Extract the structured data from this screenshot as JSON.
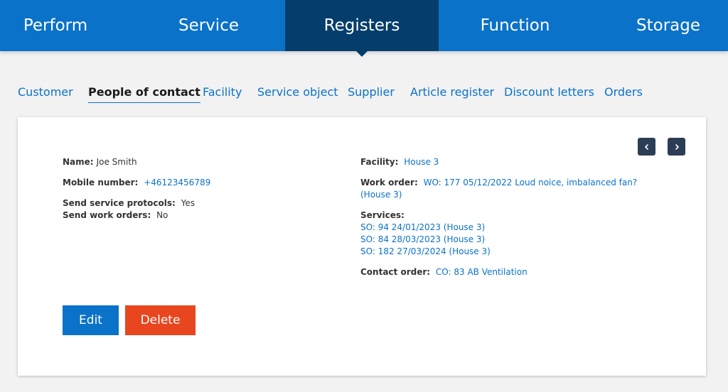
{
  "topnav": {
    "tabs": [
      {
        "label": "Perform"
      },
      {
        "label": "Service"
      },
      {
        "label": "Registers"
      },
      {
        "label": "Function"
      },
      {
        "label": "Storage"
      }
    ]
  },
  "subnav": {
    "tabs": [
      {
        "label": "Customer"
      },
      {
        "label": "People of contact"
      },
      {
        "label": "Facility"
      },
      {
        "label": "Service object"
      },
      {
        "label": "Supplier"
      },
      {
        "label": "Article register"
      },
      {
        "label": "Discount letters"
      },
      {
        "label": "Orders"
      }
    ]
  },
  "contact": {
    "name_label": "Name:",
    "name": "Joe Smith",
    "mobile_label": "Mobile number:",
    "mobile": "+46123456789",
    "protocols_label": "Send service protocols:",
    "protocols": "Yes",
    "workorders_label": "Send work orders:",
    "workorders": "No",
    "facility_label": "Facility:",
    "facility": "House 3",
    "workorder_label": "Work order:",
    "workorder_line1": "WO: 177 05/12/2022 Loud noice, imbalanced fan?",
    "workorder_line2": "(House 3)",
    "services_label": "Services:",
    "services": [
      "SO: 94 24/01/2023 (House 3)",
      "SO: 84 28/03/2023 (House 3)",
      "SO: 182 27/03/2024 (House 3)"
    ],
    "contact_order_label": "Contact order:",
    "contact_order": "CO: 83 AB Ventilation"
  },
  "actions": {
    "edit_label": "Edit",
    "delete_label": "Delete"
  },
  "icons": {
    "prev": "chevron-left-icon",
    "next": "chevron-right-icon"
  },
  "colors": {
    "primary": "#0a72c8",
    "nav_active": "#053e6d",
    "danger": "#e8461f",
    "pager": "#2c3e55"
  }
}
